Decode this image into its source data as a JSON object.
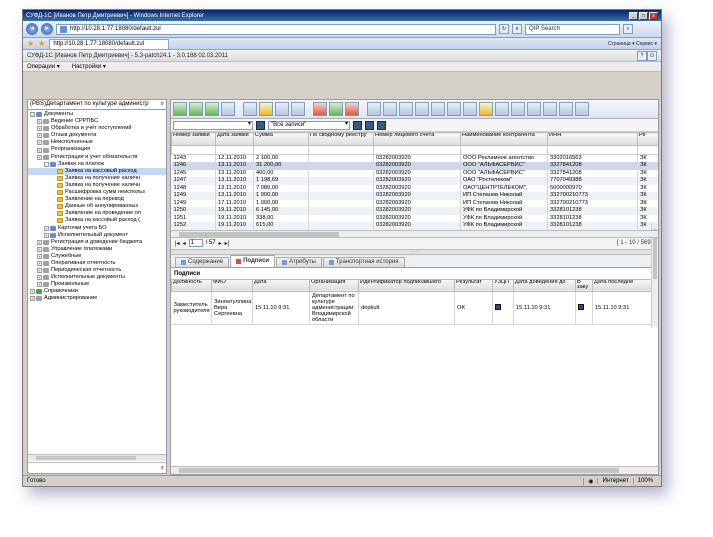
{
  "browser": {
    "title": "СУФД-1С [Иванов Петр Дмитриевич] - Windows Internet Explorer",
    "address": "http://10.28.1.77:18080/default.zul",
    "search_placeholder": "QIP Search",
    "tab_title": "http://10.28.1.77:18080/default.zul",
    "tools": "Страница ▾  Сервис ▾"
  },
  "app": {
    "header": "СУФД-1С [Иванов Петр Дмитриевич] - 5.3-patch24.1 - 3.0.188 02.03.2011",
    "menu": [
      "Операции ▾",
      "Настройки ▾"
    ]
  },
  "left": {
    "org": "(PBS)Департамент по культуре администр",
    "tree": [
      {
        "label": "Документы",
        "level": 0,
        "toggle": "-",
        "icon": "book"
      },
      {
        "label": "Ведение СРРПБС",
        "level": 1,
        "toggle": "+",
        "icon": "gry"
      },
      {
        "label": "Обработка и учёт поступлений",
        "level": 1,
        "toggle": "+",
        "icon": "gry"
      },
      {
        "label": "Отзыв документа",
        "level": 1,
        "toggle": "+",
        "icon": "gry"
      },
      {
        "label": "Неисполненные",
        "level": 1,
        "toggle": "+",
        "icon": "gry"
      },
      {
        "label": "Реорганизация",
        "level": 1,
        "toggle": "+",
        "icon": "gry"
      },
      {
        "label": "Регистрация и учет обязательств",
        "level": 1,
        "toggle": "+",
        "icon": "gry"
      },
      {
        "label": "Заявки на платеж",
        "level": 2,
        "toggle": "-",
        "icon": "book"
      },
      {
        "label": "Заявка на кассовый расход",
        "level": 3,
        "toggle": "",
        "icon": "yel",
        "selected": true
      },
      {
        "label": "Заявка на получение наличн",
        "level": 3,
        "toggle": "",
        "icon": "yel"
      },
      {
        "label": "Заявка на получение наличн",
        "level": 3,
        "toggle": "",
        "icon": "yel"
      },
      {
        "label": "Расшифровка сумм неиспольз",
        "level": 3,
        "toggle": "",
        "icon": "yel"
      },
      {
        "label": "Заявление на перевод",
        "level": 3,
        "toggle": "",
        "icon": "yel"
      },
      {
        "label": "Данные об аннулированных",
        "level": 3,
        "toggle": "",
        "icon": "yel"
      },
      {
        "label": "Заявление на проведение оп",
        "level": 3,
        "toggle": "",
        "icon": "yel"
      },
      {
        "label": "Заявка на кассовый расход (",
        "level": 3,
        "toggle": "",
        "icon": "yel"
      },
      {
        "label": "Карточки учета БО",
        "level": 2,
        "toggle": "+",
        "icon": "book"
      },
      {
        "label": "Исполнительный документ",
        "level": 2,
        "toggle": "+",
        "icon": "book"
      },
      {
        "label": "Регистрация и доведение бюджета",
        "level": 1,
        "toggle": "+",
        "icon": "gry"
      },
      {
        "label": "Управление платежами",
        "level": 1,
        "toggle": "+",
        "icon": "gry"
      },
      {
        "label": "Служебные",
        "level": 1,
        "toggle": "+",
        "icon": "gry"
      },
      {
        "label": "Оперативная отчетность",
        "level": 1,
        "toggle": "+",
        "icon": "gry"
      },
      {
        "label": "Периодическая отчетность",
        "level": 1,
        "toggle": "+",
        "icon": "gry"
      },
      {
        "label": "Исполнительные документы",
        "level": 1,
        "toggle": "+",
        "icon": "gry"
      },
      {
        "label": "Произвольные",
        "level": 1,
        "toggle": "+",
        "icon": "gry"
      },
      {
        "label": "Справочники",
        "level": 0,
        "toggle": "+",
        "icon": "grn"
      },
      {
        "label": "Администрирование",
        "level": 0,
        "toggle": "+",
        "icon": "gry"
      }
    ]
  },
  "filter": {
    "first_value": "",
    "records_value": "\"Все записи\""
  },
  "grid": {
    "columns": [
      "Номер заявки",
      "Дата заявки",
      "Сумма",
      "По сводному реестру",
      "Номер лицевого счёта",
      "Наименование контрагента",
      "ИНН",
      "Ре"
    ],
    "rows": [
      [
        "1243",
        "12.11.2010",
        "2 100,00",
        "",
        "03282003920",
        "ООО Рекламное агентство",
        "3302016563",
        "ЗК"
      ],
      [
        "1246",
        "13.11.2010",
        "31 200,00",
        "",
        "03282003920",
        "ООО \"АЛЬФАСЕРВИС\"",
        "3327841208",
        "ЗК"
      ],
      [
        "1245",
        "13.11.2010",
        "400,00",
        "",
        "03282003920",
        "ООО \"АЛЬФАСЕРВИС\"",
        "3327841208",
        "ЗК"
      ],
      [
        "1247",
        "13.11.2010",
        "1 198,69",
        "",
        "03282003920",
        "ОАО \"Ростелеком\"",
        "7707049388",
        "ЗК"
      ],
      [
        "1248",
        "13.11.2010",
        "7 080,00",
        "",
        "03282003920",
        "ОАО\"ЦЕНТРТЕЛЕКОМ\",",
        "5000000970",
        "ЗК"
      ],
      [
        "1249",
        "13.11.2010",
        "1 000,00",
        "",
        "03282003920",
        "ИП Степанов Николай",
        "332700210773",
        "ЗК"
      ],
      [
        "1249",
        "17.11.2010",
        "1 000,00",
        "",
        "03282003920",
        "ИП Степанов Николай",
        "332700210773",
        "ЗК"
      ],
      [
        "1250",
        "19.11.2010",
        "6 145,00",
        "",
        "03282003920",
        "УФК по Владимирской",
        "3328101238",
        "ЗК"
      ],
      [
        "1251",
        "19.11.2010",
        "338,00",
        "",
        "03282003920",
        "УФК по Владимирской",
        "3328101238",
        "ЗК"
      ],
      [
        "1252",
        "19.11.2010",
        "615,00",
        "",
        "03282003920",
        "УФК по Владимирской",
        "3328101238",
        "ЗК"
      ]
    ]
  },
  "pager": {
    "first": "|◂",
    "prev": "◂",
    "page": "1",
    "of": "/ 57",
    "next": "▸",
    "last": "▸|",
    "range": "[ 1 - 10 / 569 ]"
  },
  "tabs": [
    "Содержание",
    "Подписи",
    "Атрибуты",
    "Транспортная история"
  ],
  "signatures": {
    "title": "Подписи",
    "columns": [
      "Должность",
      "ФИО",
      "Дата",
      "Организация",
      "Идентификатор подписавшего",
      "Результат",
      "УЗЦП",
      "Дата доведения до",
      "В заку",
      "Дата последне"
    ],
    "rows": [
      [
        "Заместитель руководителя",
        "Зиннатуллина Вера Сергеевна",
        "15.11.10 9:31",
        "Департамент по культуре администрации Владимирской области",
        "depkult",
        "OK",
        "",
        "15.11.10 9:31",
        "",
        "15.11.10 9:31"
      ]
    ]
  },
  "statusbar": {
    "left": "Готово",
    "zone": "Интернет",
    "zoom": "100%"
  }
}
